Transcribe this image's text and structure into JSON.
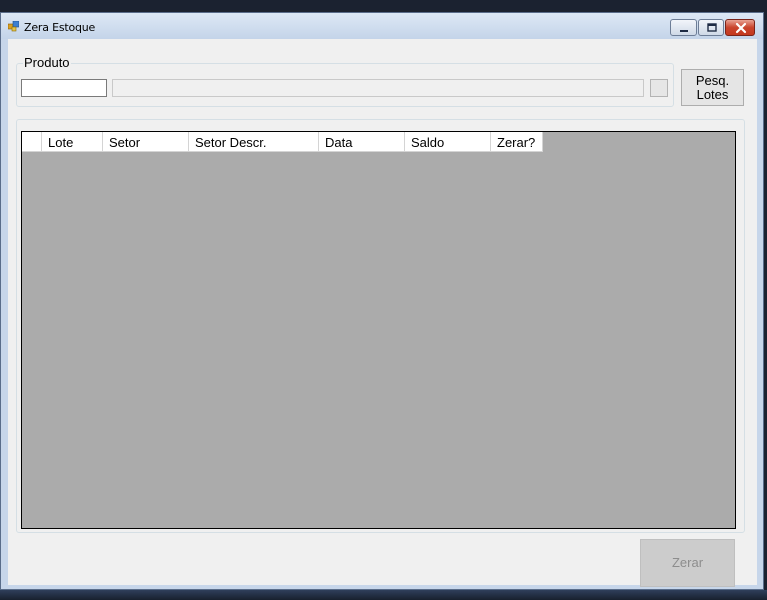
{
  "window": {
    "title": "Zera Estoque",
    "controls": [
      "minimize-icon",
      "maximize-icon",
      "close-icon"
    ]
  },
  "produto": {
    "label": "Produto",
    "code_value": "",
    "description_value": ""
  },
  "buttons": {
    "pesq_line1": "Pesq.",
    "pesq_line2": "Lotes",
    "zerar": "Zerar"
  },
  "grid": {
    "columns": [
      "",
      "Lote",
      "Setor",
      "Setor Descr.",
      "Data",
      "Saldo",
      "Zerar?"
    ],
    "rows": []
  },
  "colors": {
    "grid_background": "#ababab",
    "client_background": "#f0f0f0",
    "disabled_text": "#8d8d8d"
  }
}
